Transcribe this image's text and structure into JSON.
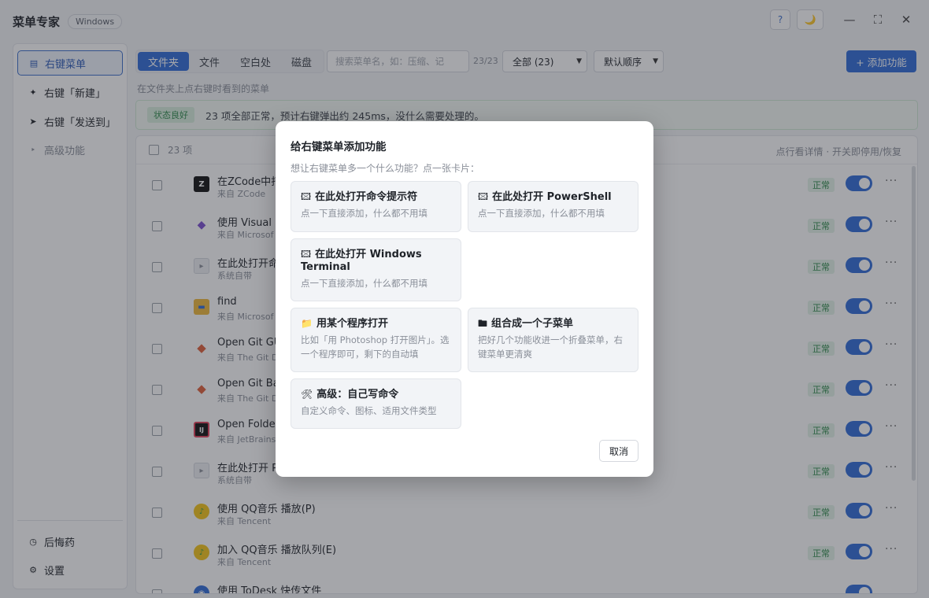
{
  "app": {
    "title": "菜单专家",
    "os_badge": "Windows",
    "help": "?",
    "theme": "🌙",
    "minimize": "—",
    "maximize": "⛶",
    "close": "✕"
  },
  "sidebar": {
    "items": [
      {
        "icon": "▤",
        "label": "右键菜单"
      },
      {
        "icon": "✦",
        "label": "右键「新建」"
      },
      {
        "icon": "➤",
        "label": "右键「发送到」"
      },
      {
        "icon": "‣",
        "label": "高级功能"
      }
    ],
    "bottom": [
      {
        "icon": "◷",
        "label": "后悔药"
      },
      {
        "icon": "⚙",
        "label": "设置"
      }
    ]
  },
  "toolbar": {
    "tabs": [
      "文件夹",
      "文件",
      "空白处",
      "磁盘"
    ],
    "search_placeholder": "搜索菜单名，如：压缩、记",
    "count": "23/23",
    "filter": "全部 (23)",
    "sort": "默认顺序",
    "add": "+ 添加功能"
  },
  "hint": "在文件夹上点右键时看到的菜单",
  "status": {
    "badge": "状态良好",
    "text": "23 项全部正常，预计右键弹出约 245ms，没什么需要处理的。"
  },
  "list": {
    "count": "23 项",
    "right_hint": "点行看详情 · 开关即停用/恢复",
    "status_label": "正常",
    "more": "···",
    "rows": [
      {
        "icon": "Z",
        "name": "在ZCode中打",
        "src": "来自 ZCode"
      },
      {
        "icon": "◆",
        "name": "使用 Visual S",
        "src": "来自 Microsof"
      },
      {
        "icon": "▸",
        "name": "在此处打开命",
        "src": "系统自带"
      },
      {
        "icon": "▬",
        "name": "find",
        "src": "来自 Microsof"
      },
      {
        "icon": "◆",
        "name": "Open Git GU",
        "src": "来自 The Git D"
      },
      {
        "icon": "◆",
        "name": "Open Git Ba",
        "src": "来自 The Git D"
      },
      {
        "icon": "IJ",
        "name": "Open Folder",
        "src": "来自 JetBrains"
      },
      {
        "icon": "▸",
        "name": "在此处打开 P",
        "src": "系统自带"
      },
      {
        "icon": "♪",
        "name": "使用 QQ音乐 播放(P)",
        "src": "来自 Tencent"
      },
      {
        "icon": "♪",
        "name": "加入 QQ音乐 播放队列(E)",
        "src": "来自 Tencent"
      },
      {
        "icon": "◉",
        "name": "使用 ToDesk 快传文件",
        "src": ""
      }
    ]
  },
  "modal": {
    "title": "给右键菜单添加功能",
    "subtitle": "想让右键菜单多一个什么功能？点一张卡片：",
    "cards": [
      {
        "icon": "🖾",
        "title": "在此处打开命令提示符",
        "desc": "点一下直接添加，什么都不用填"
      },
      {
        "icon": "🖾",
        "title": "在此处打开 PowerShell",
        "desc": "点一下直接添加，什么都不用填"
      },
      {
        "icon": "🖾",
        "title": "在此处打开 Windows Terminal",
        "desc": "点一下直接添加，什么都不用填"
      },
      {
        "icon": "📁",
        "title": "用某个程序打开",
        "desc": "比如「用 Photoshop 打开图片」。选一个程序即可，剩下的自动填"
      },
      {
        "icon": "🖿",
        "title": "组合成一个子菜单",
        "desc": "把好几个功能收进一个折叠菜单，右键菜单更清爽"
      },
      {
        "icon": "🛠",
        "title": "高级：自己写命令",
        "desc": "自定义命令、图标、适用文件类型"
      }
    ],
    "cancel": "取消"
  },
  "colors": {
    "accent": "#2f6bd8",
    "ok": "#2d8a4a"
  }
}
